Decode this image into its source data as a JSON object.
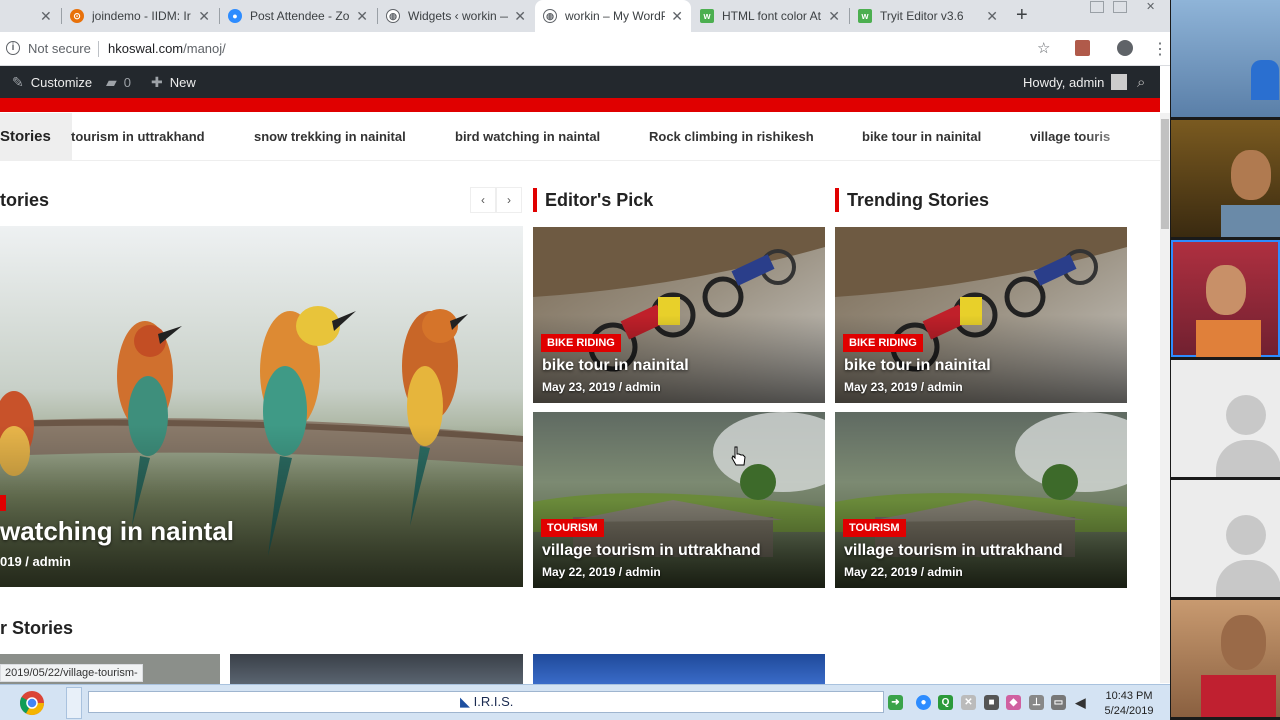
{
  "browser": {
    "tabs": [
      {
        "title": "joindemo - IIDM: Ir",
        "color": "#e8710a",
        "glyph": "⊙"
      },
      {
        "title": "Post Attendee - Zo",
        "color": "#2d8cff",
        "glyph": "●"
      },
      {
        "title": "Widgets ‹ workin —",
        "color": "#5f6368",
        "glyph": "W"
      },
      {
        "title": "workin – My WordP",
        "color": "#5f6368",
        "glyph": "W",
        "active": true
      },
      {
        "title": "HTML font color At",
        "color": "#4caf50",
        "glyph": "w"
      },
      {
        "title": "Tryit Editor v3.6",
        "color": "#4caf50",
        "glyph": "w"
      }
    ],
    "not_secure": "Not secure",
    "url_host": "hkoswal.com",
    "url_path": "/manoj/"
  },
  "wp_admin_bar": {
    "customize": "Customize",
    "comments_count": "0",
    "new_label": "New",
    "howdy": "Howdy, admin"
  },
  "ticker": {
    "label": "Stories",
    "items": [
      "tourism in uttrakhand",
      "snow trekking in nainital",
      "bird watching in naintal",
      "Rock climbing in rishikesh",
      "bike tour in nainital",
      "village touris"
    ]
  },
  "sections": {
    "featured_title": "tories",
    "editors_pick_title": "Editor's Pick",
    "trending_title": "Trending Stories",
    "bottom_title": "r Stories"
  },
  "hero": {
    "title": "watching in naintal",
    "meta": "019 / admin"
  },
  "editors_pick": [
    {
      "category": "BIKE RIDING",
      "title": "bike tour in nainital",
      "date": "May 23, 2019",
      "author": "admin",
      "meta": "May 23, 2019 / admin"
    },
    {
      "category": "TOURISM",
      "title": "village tourism in uttrakhand",
      "date": "May 22, 2019",
      "author": "admin",
      "meta": "May 22, 2019 / admin"
    }
  ],
  "trending": [
    {
      "category": "BIKE RIDING",
      "title": "bike tour in nainital",
      "meta": "May 23, 2019 / admin"
    },
    {
      "category": "TOURISM",
      "title": "village tourism in uttrakhand",
      "meta": "May 22, 2019 / admin"
    }
  ],
  "status_url": "2019/05/22/village-tourism-",
  "taskbar": {
    "app_label": "I.R.I.S.",
    "time": "10:43 PM",
    "date": "5/24/2019"
  },
  "colors": {
    "accent": "#e00000",
    "admin_bar": "#23282d"
  }
}
